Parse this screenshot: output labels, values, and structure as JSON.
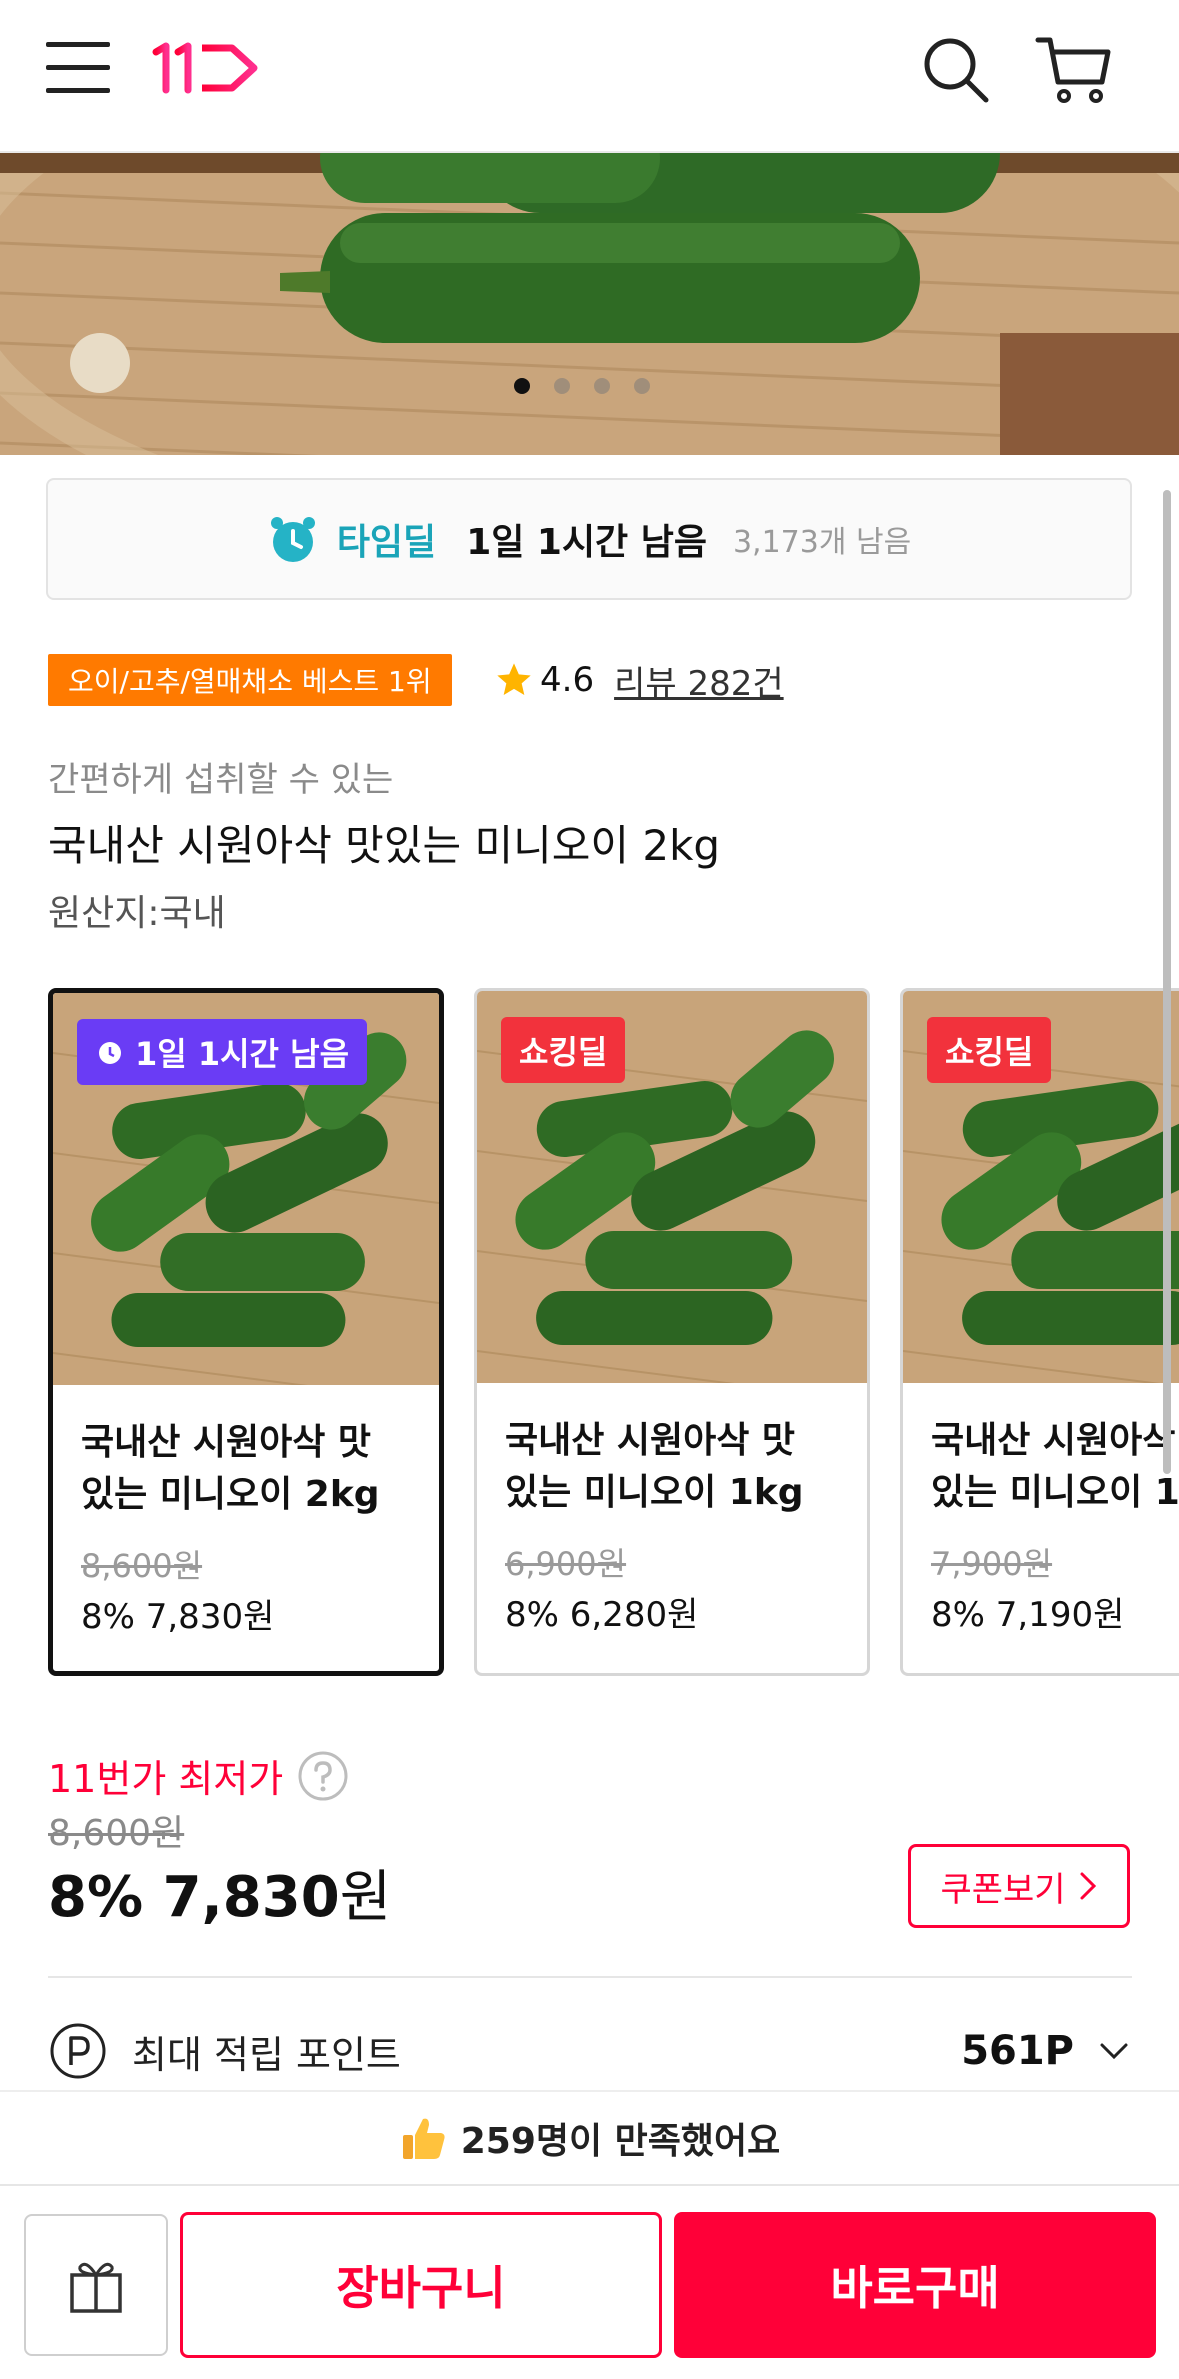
{
  "header": {
    "logo_text": "11",
    "icons": [
      "menu-icon",
      "logo",
      "search-icon",
      "cart-icon"
    ]
  },
  "hero": {
    "slides_total": 4,
    "active_slide": 1
  },
  "timedeal": {
    "label": "타임딜",
    "remaining": "1일 1시간 남음",
    "stock": "3,173개 남음"
  },
  "badges": {
    "best": "오이/고추/열매채소 베스트 1위",
    "rating": "4.6",
    "review": "리뷰 282건"
  },
  "product": {
    "subtitle": "간편하게 섭취할 수 있는",
    "title": "국내산 시원아삭 맛있는 미니오이 2kg",
    "origin": "원산지:국내"
  },
  "options": [
    {
      "tag": "1일 1시간 남음",
      "name_line1": "국내산 시원아삭 맛",
      "name_line2": "있는 미니오이 2kg",
      "orig_price": "8,600원",
      "price": "8% 7,830원",
      "selected": true
    },
    {
      "tag": "쇼킹딜",
      "name_line1": "국내산 시원아삭 맛",
      "name_line2": "있는 미니오이 1kg",
      "orig_price": "6,900원",
      "price": "8% 6,280원",
      "selected": false
    },
    {
      "tag": "쇼킹딜",
      "name_line1": "국내산 시원아삭",
      "name_line2": "있는 미니오이 1",
      "orig_price": "7,900원",
      "price": "8% 7,190원",
      "selected": false
    }
  ],
  "price": {
    "lowest_label": "11번가 최저가",
    "original": "8,600원",
    "final": "8% 7,830",
    "won": "원",
    "coupon": "쿠폰보기"
  },
  "points": {
    "label": "최대 적립 포인트",
    "value": "561P"
  },
  "satisfaction": {
    "text": "259명이 만족했어요"
  },
  "bottom": {
    "cart": "장바구니",
    "buy": "바로구매"
  },
  "colors": {
    "brand_red": "#ff0038",
    "timedeal_teal": "#1aa4b8",
    "best_orange": "#ff7a00",
    "tag_purple": "#6a3cf5",
    "tag_red": "#f2323c"
  }
}
